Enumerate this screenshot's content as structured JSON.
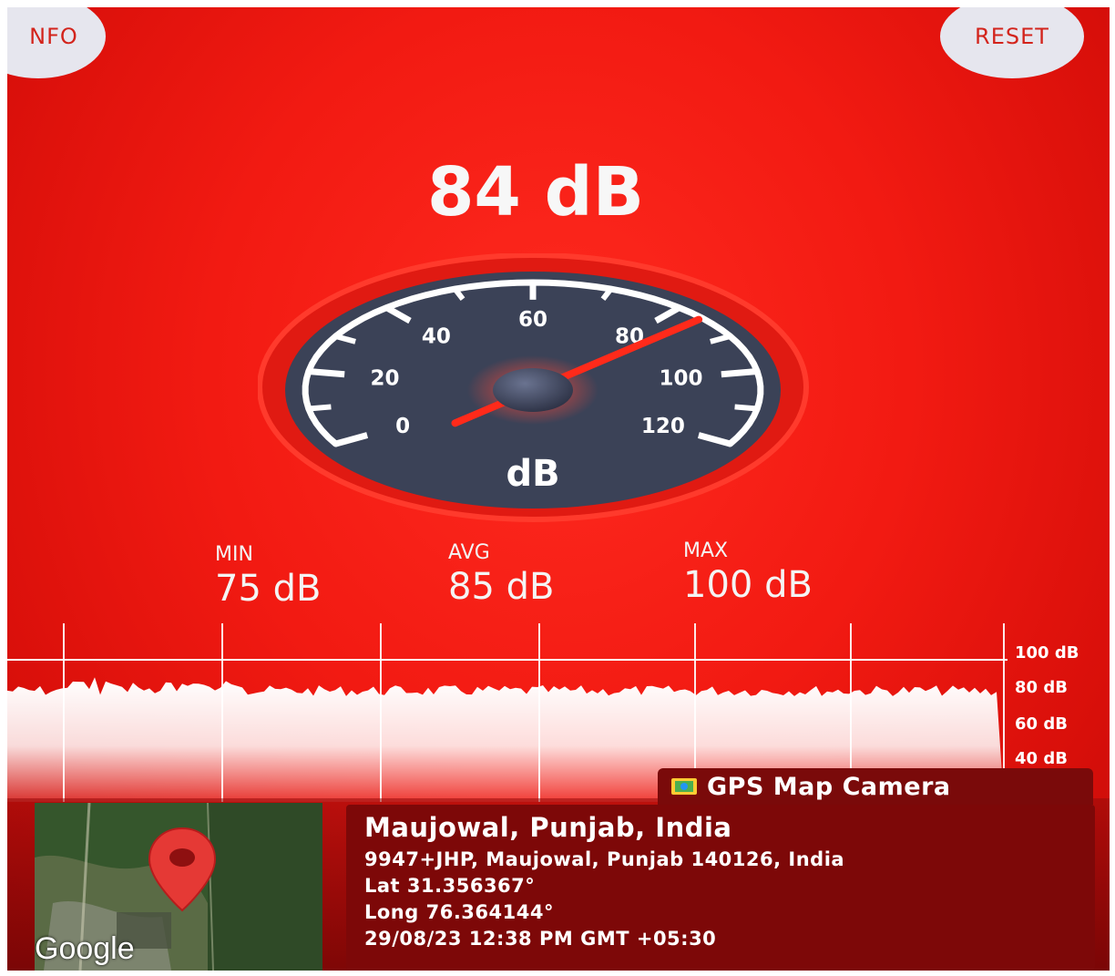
{
  "header": {
    "info_label": "NFO",
    "reset_label": "RESET"
  },
  "meter": {
    "current_reading": "84 dB",
    "current_value": 84,
    "unit_label": "dB",
    "scale_labels": [
      "0",
      "20",
      "40",
      "60",
      "80",
      "100",
      "120"
    ],
    "scale_values": [
      0,
      20,
      40,
      60,
      80,
      100,
      120
    ]
  },
  "stats": {
    "min": {
      "label": "MIN",
      "value": "75 dB"
    },
    "avg": {
      "label": "AVG",
      "value": "85 dB"
    },
    "max": {
      "label": "MAX",
      "value": "100 dB"
    }
  },
  "graph": {
    "y_labels": [
      "100 dB",
      "80 dB",
      "60 dB",
      "40 dB"
    ],
    "level_db": 84
  },
  "overlay": {
    "badge_text": "GPS Map Camera",
    "map_logo": "Google",
    "place": "Maujowal, Punjab, India",
    "address": "9947+JHP, Maujowal, Punjab 140126, India",
    "lat": "Lat 31.356367°",
    "long": "Long 76.364144°",
    "datetime": "29/08/23 12:38 PM GMT +05:30"
  },
  "colors": {
    "background": "#f21a12",
    "dial_face": "#3b4257",
    "needle": "#ff2a1a",
    "card": "#7d0808"
  }
}
